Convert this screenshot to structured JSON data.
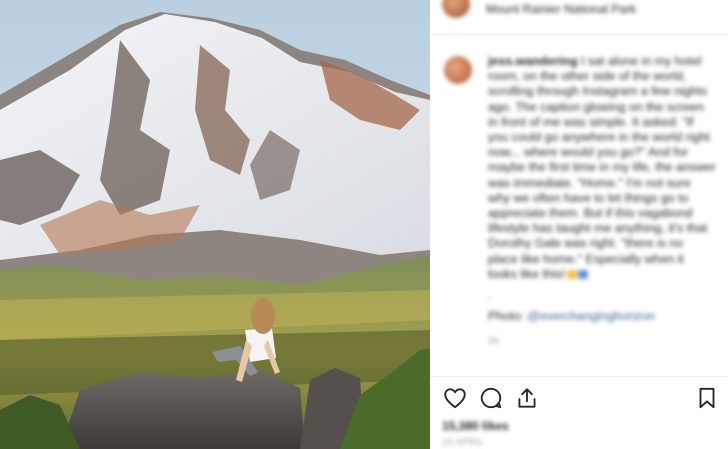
{
  "post": {
    "location": "Mount Rainier National Park",
    "username": "jess.wandering",
    "caption_text": "I sat alone in my hotel room, on the other side of the world, scrolling through Instagram a few nights ago. The caption glowing on the screen in front of me was simple. It asked: \"If you could go anywhere in the world right now... where would you go?\" And for maybe the first time in my life, the answer was immediate. \"Home.\" I'm not sure why we often have to let things go to appreciate them. But if this vagabond lifestyle has taught me anything, it's that Dorothy Gale was right. \"there is no place like home.\" Especially when it looks like this!",
    "separator": ".",
    "photo_label": "Photo:",
    "photo_credit": "@everchanginghorizon",
    "time_ago": "1h",
    "likes": "15,380 likes",
    "date": "16 APRIL"
  },
  "icons": {
    "like": "heart-icon",
    "comment": "comment-icon",
    "share": "share-icon",
    "save": "bookmark-icon"
  },
  "colors": {
    "link": "#3f5d8a",
    "text": "#262626",
    "muted": "#999999"
  }
}
